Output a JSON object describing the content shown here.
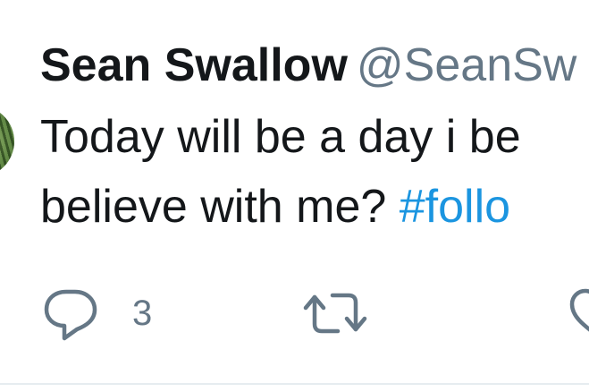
{
  "tweet": {
    "author_name": "Sean Swallow",
    "author_handle": "@SeanSw",
    "text_line1": "Today will be a day i be",
    "text_line2_prefix": "believe with me? ",
    "hashtag": "#follo",
    "reply_count": "3",
    "retweet_count": "",
    "like_count": ""
  },
  "colors": {
    "text": "#14171a",
    "secondary": "#657786",
    "link": "#1b95e0",
    "divider": "#e6ecf0"
  },
  "icons": [
    "avatar",
    "reply-icon",
    "retweet-icon",
    "like-icon"
  ]
}
